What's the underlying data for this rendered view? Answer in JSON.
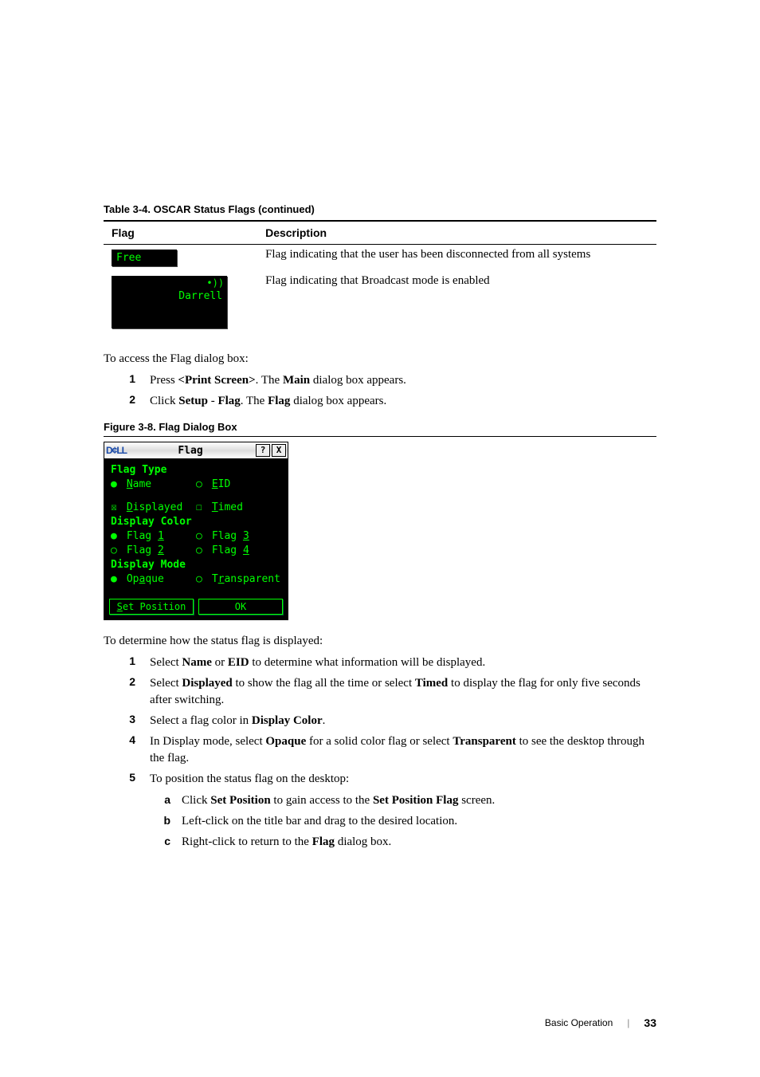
{
  "table": {
    "caption": "Table 3-4.   OSCAR Status Flags (continued)",
    "headers": [
      "Flag",
      "Description"
    ],
    "rows": [
      {
        "flag_text": "Free",
        "desc": "Flag indicating that the user has been disconnected from all systems"
      },
      {
        "flag_text": "Darrell",
        "desc": "Flag indicating that Broadcast mode is enabled",
        "has_broadcast_icon": true
      }
    ]
  },
  "intro_access": "To access the Flag dialog box:",
  "steps_access": [
    {
      "n": "1",
      "plain_before": "Press ",
      "bold1": "<Print Screen>",
      "mid": ". The ",
      "bold2": "Main",
      "after": " dialog box appears."
    },
    {
      "n": "2",
      "plain_before": "Click ",
      "bold1": "Setup",
      "mid": " - ",
      "bold2": "Flag",
      "after_prebold": ". The ",
      "bold3": "Flag",
      "after": " dialog box appears."
    }
  ],
  "figure": {
    "caption": "Figure 3-8.   Flag Dialog Box",
    "title": "Flag",
    "logo": "D¢LL",
    "groups": {
      "flag_type": {
        "label": "Flag Type",
        "opts": [
          {
            "sel": "●",
            "u": "N",
            "rest": "ame"
          },
          {
            "sel": "○",
            "u": "E",
            "rest": "ID"
          }
        ]
      },
      "displayed": {
        "sel": "☒",
        "u": "D",
        "rest": "isplayed"
      },
      "timed": {
        "sel": "☐",
        "u": "T",
        "rest": "imed"
      },
      "display_color": {
        "label": "Display Color",
        "opts": [
          {
            "sel": "●",
            "pre": "Flag ",
            "u": "1"
          },
          {
            "sel": "○",
            "pre": "Flag ",
            "u": "3"
          },
          {
            "sel": "○",
            "pre": "Flag ",
            "u": "2"
          },
          {
            "sel": "○",
            "pre": "Flag ",
            "u": "4"
          }
        ]
      },
      "display_mode": {
        "label": "Display Mode",
        "opts": [
          {
            "sel": "●",
            "pre": "Op",
            "u": "a",
            "post": "que"
          },
          {
            "sel": "○",
            "pre": "T",
            "u": "r",
            "post": "ansparent"
          }
        ]
      }
    },
    "buttons": {
      "set_position": {
        "u": "S",
        "rest": "et Position"
      },
      "ok": "OK"
    },
    "titlebar_icons": {
      "help": "?",
      "close": "X"
    }
  },
  "determine_intro": "To determine how the status flag is displayed:",
  "steps_determine": [
    {
      "n": "1",
      "t_before": "Select ",
      "b1": "Name",
      "t_mid": " or ",
      "b2": "EID",
      "t_after": " to determine what information will be displayed."
    },
    {
      "n": "2",
      "t_before": "Select ",
      "b1": "Displayed",
      "t_mid": " to show the flag all the time or select ",
      "b2": "Timed",
      "t_after": " to display the flag for only five seconds after switching."
    },
    {
      "n": "3",
      "t_before": "Select a flag color in ",
      "b1": "Display Color",
      "t_after": "."
    },
    {
      "n": "4",
      "t_before": "In Display mode, select ",
      "b1": "Opaque",
      "t_mid": " for a solid color flag or select ",
      "b2": "Transparent",
      "t_after": " to see the desktop through the flag."
    },
    {
      "n": "5",
      "t_before": "To position the status flag on the desktop:"
    }
  ],
  "substeps": [
    {
      "m": "a",
      "t_before": "Click ",
      "b1": "Set Position",
      "t_mid": " to gain access to the ",
      "b2": "Set Position Flag",
      "t_after": " screen."
    },
    {
      "m": "b",
      "t_before": "Left-click on the title bar and drag to the desired location."
    },
    {
      "m": "c",
      "t_before": "Right-click to return to the ",
      "b1": "Flag",
      "t_after": " dialog box."
    }
  ],
  "footer": {
    "section": "Basic Operation",
    "page": "33"
  }
}
